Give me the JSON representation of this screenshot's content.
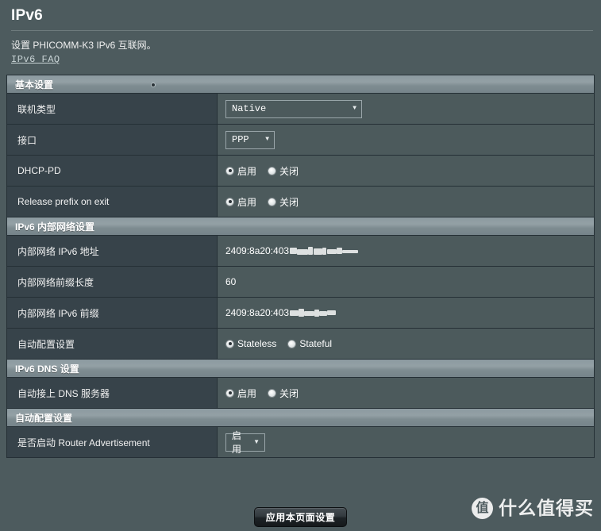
{
  "page": {
    "title": "IPv6",
    "description": "设置 PHICOMM-K3 IPv6 互联网。",
    "faq_link": "IPv6 FAQ"
  },
  "sections": [
    {
      "title": "基本设置",
      "rows": [
        {
          "label": "联机类型",
          "value": "Native",
          "caret": "▼"
        },
        {
          "label": "接口",
          "value": "PPP",
          "caret": "▼"
        },
        {
          "label": "DHCP-PD",
          "on": "启用",
          "off": "关闭"
        },
        {
          "label": "Release prefix on exit",
          "on": "启用",
          "off": "关闭"
        }
      ]
    },
    {
      "title": "IPv6 内部网络设置",
      "rows": [
        {
          "label": "内部网络 IPv6 地址",
          "value": "2409:8a20:403"
        },
        {
          "label": "内部网络前缀长度",
          "value": "60"
        },
        {
          "label": "内部网络 IPv6 前缀",
          "value": "2409:8a20:403"
        },
        {
          "label": "自动配置设置",
          "on": "Stateless",
          "off": "Stateful"
        }
      ]
    },
    {
      "title": "IPv6 DNS 设置",
      "rows": [
        {
          "label": "自动接上 DNS 服务器",
          "on": "启用",
          "off": "关闭"
        }
      ]
    },
    {
      "title": "自动配置设置",
      "rows": [
        {
          "label": "是否启动 Router Advertisement",
          "value": "启用",
          "caret": "▼"
        }
      ]
    }
  ],
  "footer": {
    "apply_label": "应用本页面设置"
  },
  "watermark": {
    "badge": "值",
    "text": "什么值得买"
  },
  "colors": {
    "page_bg": "#4d5b5e",
    "label_bg": "#37434a",
    "value_bg": "#4c5a5c",
    "border": "#253036",
    "section_head": "#8c9aa0"
  }
}
